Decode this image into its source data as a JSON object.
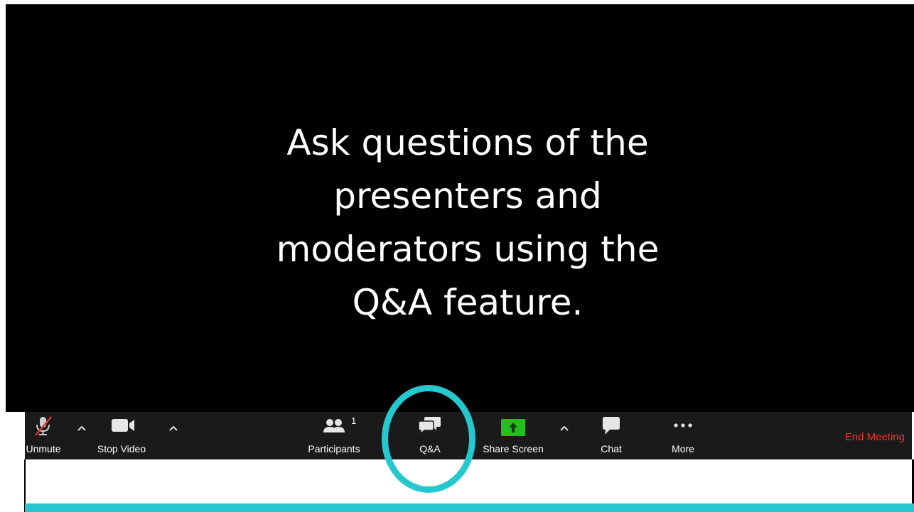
{
  "slide": {
    "headline": "Ask questions of the\npresenters and\nmoderators using the\nQ&A feature."
  },
  "toolbar": {
    "unmute_label": "Unmute",
    "stop_video_label": "Stop Video",
    "participants_label": "Participants",
    "participants_count": "1",
    "qa_label": "Q&A",
    "share_screen_label": "Share Screen",
    "chat_label": "Chat",
    "more_label": "More",
    "end_meeting_label": "End Meeting"
  },
  "icons": {
    "unmute": "muted-microphone-icon",
    "audio_options": "chevron-up-icon",
    "video": "video-camera-icon",
    "video_options": "chevron-up-icon",
    "participants": "participants-icon",
    "qa": "qa-bubbles-icon",
    "share_screen": "share-screen-icon",
    "share_options": "chevron-up-icon",
    "chat": "chat-bubble-icon",
    "more": "more-dots-icon"
  },
  "colors": {
    "slide_background": "#000000",
    "toolbar_background": "#1a1a1a",
    "accent_teal": "#26c8d0",
    "share_green": "#22c01c",
    "end_meeting_red": "#e8372d",
    "mute_slash_red": "#e8372d"
  }
}
